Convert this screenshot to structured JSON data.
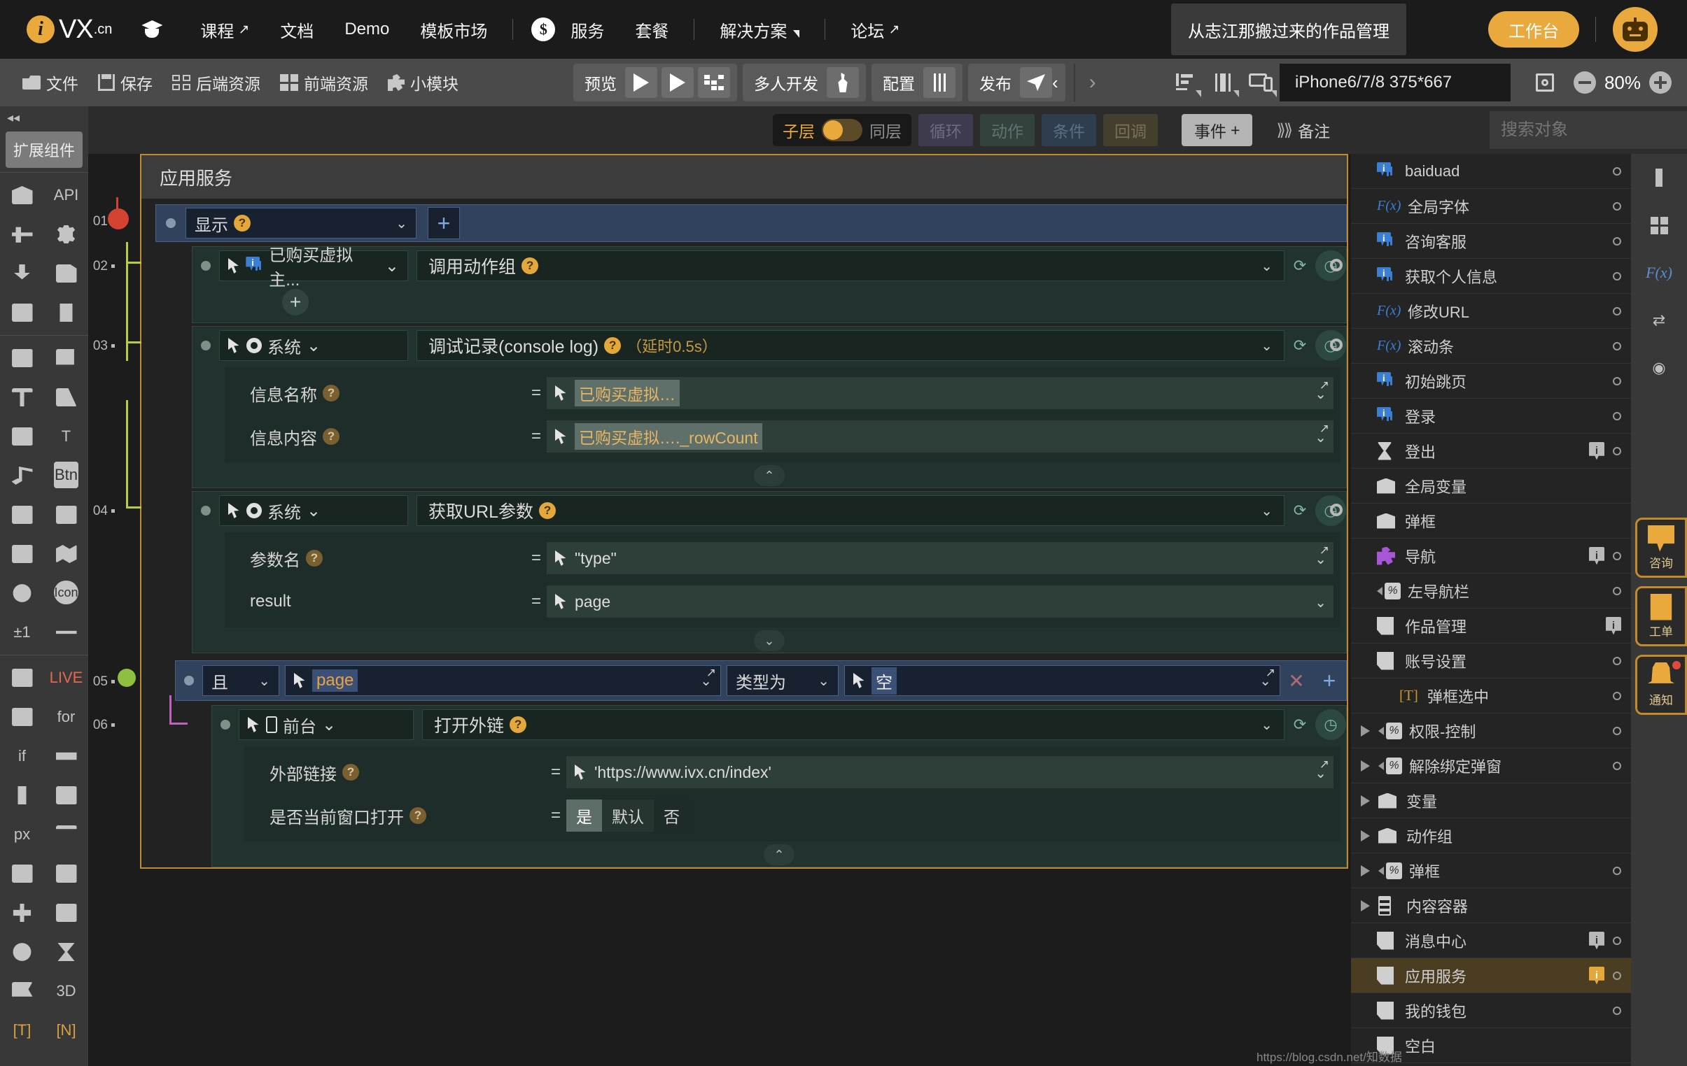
{
  "topnav": {
    "brand": {
      "mark": "i",
      "name": "VX",
      "suffix": ".cn"
    },
    "items": [
      {
        "label": "课程",
        "arrow": "↗",
        "name": "nav-courses"
      },
      {
        "label": "文档",
        "arrow": "",
        "name": "nav-docs"
      },
      {
        "label": "Demo",
        "arrow": "",
        "name": "nav-demo"
      },
      {
        "label": "模板市场",
        "arrow": "",
        "name": "nav-template-market"
      },
      {
        "label": "服务",
        "arrow": "",
        "name": "nav-service"
      },
      {
        "label": "套餐",
        "arrow": "",
        "name": "nav-package"
      },
      {
        "label": "解决方案",
        "arrow": "",
        "name": "nav-solutions"
      },
      {
        "label": "论坛",
        "arrow": "↗",
        "name": "nav-forum"
      }
    ],
    "tooltip": "从志江那搬过来的作品管理",
    "workbench": "工作台"
  },
  "toolbar": {
    "left": [
      {
        "label": "文件",
        "icon": "folder-icon"
      },
      {
        "label": "保存",
        "icon": "save-icon"
      },
      {
        "label": "后端资源",
        "icon": "backend-resource-icon"
      },
      {
        "label": "前端资源",
        "icon": "frontend-resource-icon"
      },
      {
        "label": "小模块",
        "icon": "puzzle-icon"
      }
    ],
    "preview_label": "预览",
    "multiuser_label": "多人开发",
    "config_label": "配置",
    "publish_label": "发布",
    "device": "iPhone6/7/8 375*667",
    "zoom": "80%"
  },
  "bar2": {
    "toggle_on": "子层",
    "toggle_off": "同层",
    "tags": [
      "循环",
      "动作",
      "条件",
      "回调"
    ],
    "event_button": "事件",
    "event_plus": "+",
    "remark": "备注",
    "search_placeholder": "搜索对象"
  },
  "leftrail": {
    "title": "扩展组件",
    "cells": [
      "box-icon",
      "api-icon",
      "share-node-icon",
      "gear-icon",
      "download-icon",
      "upload-file-icon",
      "window-list-icon",
      "device-signal-icon",
      "image-icon",
      "images-icon",
      "text-T-icon",
      "translate-icon",
      "edit-pencil-icon",
      "button-icon",
      "music-note-icon",
      "video-icon",
      "richtext-icon",
      "webpage-text-icon",
      "browser-ie-icon",
      "map-icon",
      "icon-font-icon",
      "plus-minus-one-icon",
      "qrcode-icon",
      "line-icon",
      "live-icon",
      "blank-icon",
      "for-loop-icon",
      "if-icon",
      "component-icon",
      "progress-icon",
      "slider-v-icon",
      "px-icon",
      "percent-icon",
      "sort-icon",
      "table-icon",
      "list-icon",
      "sitemap-icon",
      "blank2-icon",
      "clock-icon",
      "hourglass-icon",
      "flag-icon",
      "threed-icon",
      "bracket-T-icon",
      "bracket-N-icon"
    ],
    "cell_labels": {
      "1": "API",
      "13": "T",
      "15": "Btn",
      "21": "Icon",
      "22": "±1",
      "27": "for",
      "28": "if",
      "32": "px",
      "41": "3D",
      "42": "[T]",
      "43": "[N]",
      "25": "LIVE"
    }
  },
  "canvas": {
    "panel_title": "应用服务",
    "rows": [
      {
        "num": "01",
        "type": "event",
        "object": "显示",
        "has_help": true,
        "plus": "+"
      },
      {
        "num": "02",
        "type": "action",
        "object": "已购买虚拟主...",
        "object_icon": "message-icon",
        "title": "调用动作组",
        "has_help": true,
        "params": []
      },
      {
        "num": "03",
        "type": "action",
        "object": "系统",
        "object_icon": "gear-icon",
        "title": "调试记录(console log)",
        "delay": "（延时0.5s）",
        "has_help": true,
        "params": [
          {
            "label": "信息名称",
            "help": true,
            "eq": "=",
            "value": "已购买虚拟…",
            "highlight": true,
            "suffix": ""
          },
          {
            "label": "信息内容",
            "help": true,
            "eq": "=",
            "value": "已购买虚拟…",
            "highlight": true,
            "suffix": "._rowCount"
          }
        ],
        "collapse": "⌃"
      },
      {
        "num": "04",
        "type": "action",
        "object": "系统",
        "object_icon": "gear-icon",
        "title": "获取URL参数",
        "has_help": true,
        "params": [
          {
            "label": "参数名",
            "help": true,
            "eq": "=",
            "value": "\"type\"",
            "highlight": false
          },
          {
            "label": "result",
            "help": false,
            "eq": "=",
            "value": "page",
            "highlight": false
          }
        ],
        "collapse": "⌄"
      },
      {
        "num": "05",
        "type": "condition",
        "logic": "且",
        "left_value": "page",
        "operator": "类型为",
        "right_value": "空",
        "close": "✕",
        "plus": "+"
      },
      {
        "num": "06",
        "type": "action",
        "object": "前台",
        "object_icon": "mobile-icon",
        "title": "打开外链",
        "has_help": true,
        "params": [
          {
            "label": "外部链接",
            "help": true,
            "eq": "=",
            "value": "'https://www.ivx.cn/index'",
            "highlight": false
          },
          {
            "label": "是否当前窗口打开",
            "help": true,
            "eq": "=",
            "segments": [
              "是",
              "默认",
              "否"
            ],
            "selected": 0
          }
        ],
        "collapse": "⌃"
      }
    ]
  },
  "rightpanel": {
    "items": [
      {
        "label": "baiduad",
        "icon": "message-icon",
        "dot": true,
        "badge": "",
        "expand": false,
        "indent": 0
      },
      {
        "label": "全局字体",
        "icon": "fx-icon",
        "dot": true,
        "badge": "",
        "expand": false,
        "indent": 0
      },
      {
        "label": "咨询客服",
        "icon": "message-icon",
        "dot": true,
        "badge": "",
        "expand": false,
        "indent": 0
      },
      {
        "label": "获取个人信息",
        "icon": "message-icon",
        "dot": true,
        "badge": "",
        "expand": false,
        "indent": 0
      },
      {
        "label": "修改URL",
        "icon": "fx-icon",
        "dot": true,
        "badge": "",
        "expand": false,
        "indent": 0
      },
      {
        "label": "滚动条",
        "icon": "fx-icon",
        "dot": true,
        "badge": "",
        "expand": false,
        "indent": 0
      },
      {
        "label": "初始跳页",
        "icon": "message-icon",
        "dot": true,
        "badge": "",
        "expand": false,
        "indent": 0
      },
      {
        "label": "登录",
        "icon": "message-icon",
        "dot": true,
        "badge": "",
        "expand": false,
        "indent": 0
      },
      {
        "label": "登出",
        "icon": "hourglass-icon",
        "dot": true,
        "badge": "i",
        "expand": false,
        "indent": 0
      },
      {
        "label": "全局变量",
        "icon": "box-icon",
        "dot": false,
        "badge": "",
        "expand": false,
        "indent": 0
      },
      {
        "label": "弹框",
        "icon": "box-icon",
        "dot": false,
        "badge": "",
        "expand": false,
        "indent": 0
      },
      {
        "label": "导航",
        "icon": "nav-puzzle-icon",
        "dot": true,
        "badge": "i",
        "expand": false,
        "indent": 0
      },
      {
        "label": "左导航栏",
        "icon": "percent-icon",
        "dot": true,
        "badge": "",
        "expand": false,
        "indent": 0
      },
      {
        "label": "作品管理",
        "icon": "page-icon",
        "dot": false,
        "badge": "i",
        "expand": false,
        "indent": 0
      },
      {
        "label": "账号设置",
        "icon": "page-icon",
        "dot": true,
        "badge": "",
        "expand": false,
        "indent": 0
      },
      {
        "label": "弹框选中",
        "icon": "bracket-T-icon",
        "dot": true,
        "badge": "",
        "expand": false,
        "indent": 1
      },
      {
        "label": "权限-控制",
        "icon": "percent-icon",
        "dot": true,
        "badge": "",
        "expand": true,
        "indent": 0
      },
      {
        "label": "解除绑定弹窗",
        "icon": "percent-icon",
        "dot": true,
        "badge": "",
        "expand": true,
        "indent": 0
      },
      {
        "label": "变量",
        "icon": "box-icon",
        "dot": false,
        "badge": "",
        "expand": true,
        "indent": 0
      },
      {
        "label": "动作组",
        "icon": "box-icon",
        "dot": false,
        "badge": "",
        "expand": true,
        "indent": 0
      },
      {
        "label": "弹框",
        "icon": "percent-icon",
        "dot": true,
        "badge": "",
        "expand": true,
        "indent": 0
      },
      {
        "label": "内容容器",
        "icon": "content-container-icon",
        "dot": false,
        "badge": "",
        "expand": true,
        "indent": 0
      },
      {
        "label": "消息中心",
        "icon": "page-icon",
        "dot": true,
        "badge": "i",
        "expand": false,
        "indent": 0
      },
      {
        "label": "应用服务",
        "icon": "page-icon",
        "dot": true,
        "badge": "i",
        "badge_amber": true,
        "expand": false,
        "indent": 0,
        "selected": true
      },
      {
        "label": "我的钱包",
        "icon": "page-icon",
        "dot": true,
        "badge": "",
        "expand": false,
        "indent": 0
      },
      {
        "label": "空白",
        "icon": "page-icon",
        "dot": false,
        "badge": "",
        "expand": false,
        "indent": 0
      }
    ]
  },
  "floatwidgets": [
    {
      "label": "咨询",
      "name": "consult-widget"
    },
    {
      "label": "工单",
      "name": "ticket-widget"
    },
    {
      "label": "通知",
      "name": "notification-widget"
    }
  ],
  "watermark": "https://blog.csdn.net/知数据"
}
